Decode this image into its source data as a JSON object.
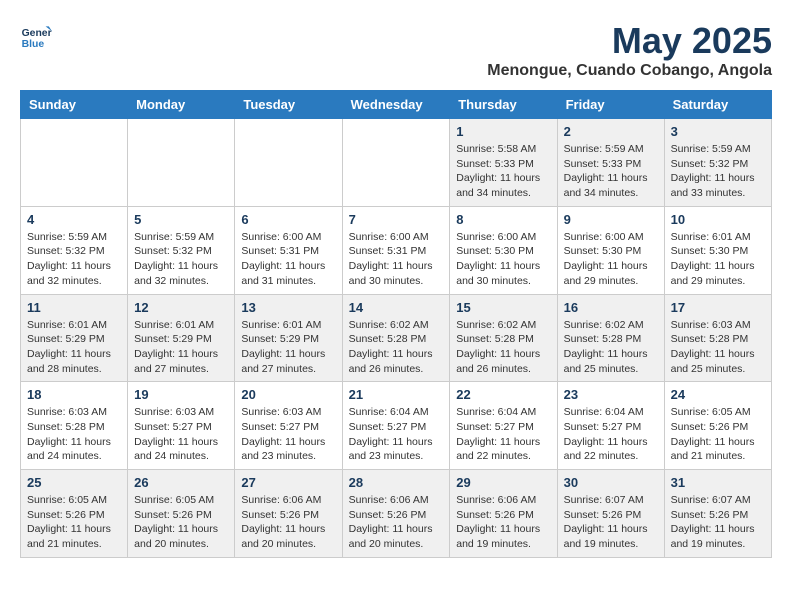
{
  "logo": {
    "line1": "General",
    "line2": "Blue"
  },
  "title": "May 2025",
  "subtitle": "Menongue, Cuando Cobango, Angola",
  "weekdays": [
    "Sunday",
    "Monday",
    "Tuesday",
    "Wednesday",
    "Thursday",
    "Friday",
    "Saturday"
  ],
  "weeks": [
    [
      {
        "day": "",
        "info": ""
      },
      {
        "day": "",
        "info": ""
      },
      {
        "day": "",
        "info": ""
      },
      {
        "day": "",
        "info": ""
      },
      {
        "day": "1",
        "info": "Sunrise: 5:58 AM\nSunset: 5:33 PM\nDaylight: 11 hours\nand 34 minutes."
      },
      {
        "day": "2",
        "info": "Sunrise: 5:59 AM\nSunset: 5:33 PM\nDaylight: 11 hours\nand 34 minutes."
      },
      {
        "day": "3",
        "info": "Sunrise: 5:59 AM\nSunset: 5:32 PM\nDaylight: 11 hours\nand 33 minutes."
      }
    ],
    [
      {
        "day": "4",
        "info": "Sunrise: 5:59 AM\nSunset: 5:32 PM\nDaylight: 11 hours\nand 32 minutes."
      },
      {
        "day": "5",
        "info": "Sunrise: 5:59 AM\nSunset: 5:32 PM\nDaylight: 11 hours\nand 32 minutes."
      },
      {
        "day": "6",
        "info": "Sunrise: 6:00 AM\nSunset: 5:31 PM\nDaylight: 11 hours\nand 31 minutes."
      },
      {
        "day": "7",
        "info": "Sunrise: 6:00 AM\nSunset: 5:31 PM\nDaylight: 11 hours\nand 30 minutes."
      },
      {
        "day": "8",
        "info": "Sunrise: 6:00 AM\nSunset: 5:30 PM\nDaylight: 11 hours\nand 30 minutes."
      },
      {
        "day": "9",
        "info": "Sunrise: 6:00 AM\nSunset: 5:30 PM\nDaylight: 11 hours\nand 29 minutes."
      },
      {
        "day": "10",
        "info": "Sunrise: 6:01 AM\nSunset: 5:30 PM\nDaylight: 11 hours\nand 29 minutes."
      }
    ],
    [
      {
        "day": "11",
        "info": "Sunrise: 6:01 AM\nSunset: 5:29 PM\nDaylight: 11 hours\nand 28 minutes."
      },
      {
        "day": "12",
        "info": "Sunrise: 6:01 AM\nSunset: 5:29 PM\nDaylight: 11 hours\nand 27 minutes."
      },
      {
        "day": "13",
        "info": "Sunrise: 6:01 AM\nSunset: 5:29 PM\nDaylight: 11 hours\nand 27 minutes."
      },
      {
        "day": "14",
        "info": "Sunrise: 6:02 AM\nSunset: 5:28 PM\nDaylight: 11 hours\nand 26 minutes."
      },
      {
        "day": "15",
        "info": "Sunrise: 6:02 AM\nSunset: 5:28 PM\nDaylight: 11 hours\nand 26 minutes."
      },
      {
        "day": "16",
        "info": "Sunrise: 6:02 AM\nSunset: 5:28 PM\nDaylight: 11 hours\nand 25 minutes."
      },
      {
        "day": "17",
        "info": "Sunrise: 6:03 AM\nSunset: 5:28 PM\nDaylight: 11 hours\nand 25 minutes."
      }
    ],
    [
      {
        "day": "18",
        "info": "Sunrise: 6:03 AM\nSunset: 5:28 PM\nDaylight: 11 hours\nand 24 minutes."
      },
      {
        "day": "19",
        "info": "Sunrise: 6:03 AM\nSunset: 5:27 PM\nDaylight: 11 hours\nand 24 minutes."
      },
      {
        "day": "20",
        "info": "Sunrise: 6:03 AM\nSunset: 5:27 PM\nDaylight: 11 hours\nand 23 minutes."
      },
      {
        "day": "21",
        "info": "Sunrise: 6:04 AM\nSunset: 5:27 PM\nDaylight: 11 hours\nand 23 minutes."
      },
      {
        "day": "22",
        "info": "Sunrise: 6:04 AM\nSunset: 5:27 PM\nDaylight: 11 hours\nand 22 minutes."
      },
      {
        "day": "23",
        "info": "Sunrise: 6:04 AM\nSunset: 5:27 PM\nDaylight: 11 hours\nand 22 minutes."
      },
      {
        "day": "24",
        "info": "Sunrise: 6:05 AM\nSunset: 5:26 PM\nDaylight: 11 hours\nand 21 minutes."
      }
    ],
    [
      {
        "day": "25",
        "info": "Sunrise: 6:05 AM\nSunset: 5:26 PM\nDaylight: 11 hours\nand 21 minutes."
      },
      {
        "day": "26",
        "info": "Sunrise: 6:05 AM\nSunset: 5:26 PM\nDaylight: 11 hours\nand 20 minutes."
      },
      {
        "day": "27",
        "info": "Sunrise: 6:06 AM\nSunset: 5:26 PM\nDaylight: 11 hours\nand 20 minutes."
      },
      {
        "day": "28",
        "info": "Sunrise: 6:06 AM\nSunset: 5:26 PM\nDaylight: 11 hours\nand 20 minutes."
      },
      {
        "day": "29",
        "info": "Sunrise: 6:06 AM\nSunset: 5:26 PM\nDaylight: 11 hours\nand 19 minutes."
      },
      {
        "day": "30",
        "info": "Sunrise: 6:07 AM\nSunset: 5:26 PM\nDaylight: 11 hours\nand 19 minutes."
      },
      {
        "day": "31",
        "info": "Sunrise: 6:07 AM\nSunset: 5:26 PM\nDaylight: 11 hours\nand 19 minutes."
      }
    ]
  ]
}
